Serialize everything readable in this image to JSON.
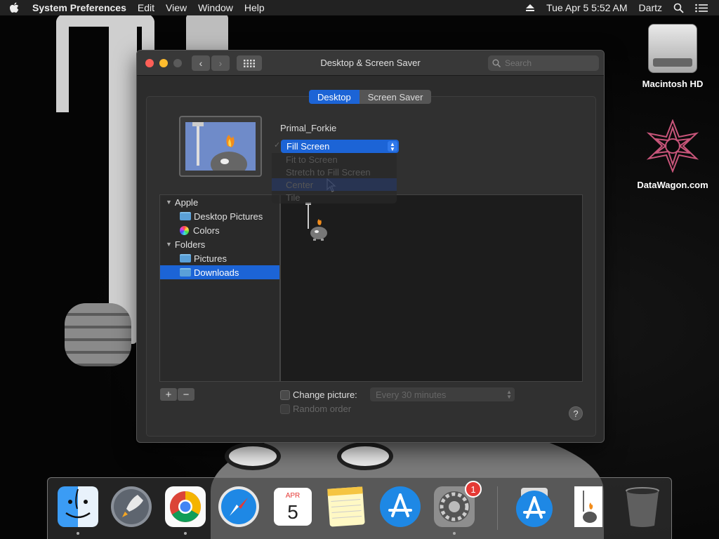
{
  "menubar": {
    "apple_icon": "apple-logo",
    "app_name": "System Preferences",
    "menus": [
      "Edit",
      "View",
      "Window",
      "Help"
    ],
    "eject_icon": "eject-icon",
    "clock": "Tue Apr 5  5:52 AM",
    "user": "Dartz",
    "search_icon": "spotlight-icon",
    "list_icon": "notification-center-icon"
  },
  "desktop": {
    "icons": [
      {
        "label": "Macintosh HD",
        "icon": "hard-drive-icon"
      },
      {
        "label": "DataWagon.com",
        "icon": "datawagon-icon"
      }
    ]
  },
  "window": {
    "title": "Desktop & Screen Saver",
    "search_placeholder": "Search",
    "tabs": [
      {
        "label": "Desktop",
        "active": true
      },
      {
        "label": "Screen Saver",
        "active": false
      }
    ],
    "image_name": "Primal_Forkie",
    "fit": {
      "selected": "Fill Screen",
      "options": [
        "Fit to Screen",
        "Stretch to Fill Screen",
        "Center",
        "Tile"
      ],
      "hovered": "Center"
    },
    "sources": {
      "groups": [
        {
          "label": "Apple",
          "items": [
            {
              "label": "Desktop Pictures",
              "icon": "folder-icon",
              "selected": false
            },
            {
              "label": "Colors",
              "icon": "colors-icon",
              "selected": false
            }
          ]
        },
        {
          "label": "Folders",
          "items": [
            {
              "label": "Pictures",
              "icon": "folder-icon",
              "selected": false
            },
            {
              "label": "Downloads",
              "icon": "folder-icon",
              "selected": true
            }
          ]
        }
      ]
    },
    "add_label": "+",
    "remove_label": "−",
    "change_picture_label": "Change picture:",
    "interval": "Every 30 minutes",
    "random_order_label": "Random order",
    "help_label": "?"
  },
  "dock": {
    "items": [
      {
        "name": "Finder",
        "icon": "finder-icon",
        "running": true
      },
      {
        "name": "Launchpad",
        "icon": "launchpad-icon",
        "running": false
      },
      {
        "name": "Google Chrome",
        "icon": "chrome-icon",
        "running": true
      },
      {
        "name": "Safari",
        "icon": "safari-icon",
        "running": false
      },
      {
        "name": "Calendar",
        "icon": "calendar-icon",
        "running": false,
        "month": "APR",
        "day": "5"
      },
      {
        "name": "Notes",
        "icon": "notes-icon",
        "running": false
      },
      {
        "name": "App Store",
        "icon": "app-store-icon",
        "running": false
      },
      {
        "name": "System Preferences",
        "icon": "system-preferences-icon",
        "running": true,
        "badge": "1"
      },
      {
        "name": "Downloads",
        "icon": "downloads-stack-icon",
        "running": false
      },
      {
        "name": "Primal_Forkie",
        "icon": "image-document-icon",
        "running": false
      },
      {
        "name": "Trash",
        "icon": "trash-icon",
        "running": false
      }
    ]
  },
  "colors": {
    "accent": "#1c64d6",
    "menubar_bg": "#222222",
    "window_bg": "#2c2c2c",
    "close": "#fe5f57",
    "minimize": "#febc2e",
    "zoom": "#5a5a5a"
  }
}
